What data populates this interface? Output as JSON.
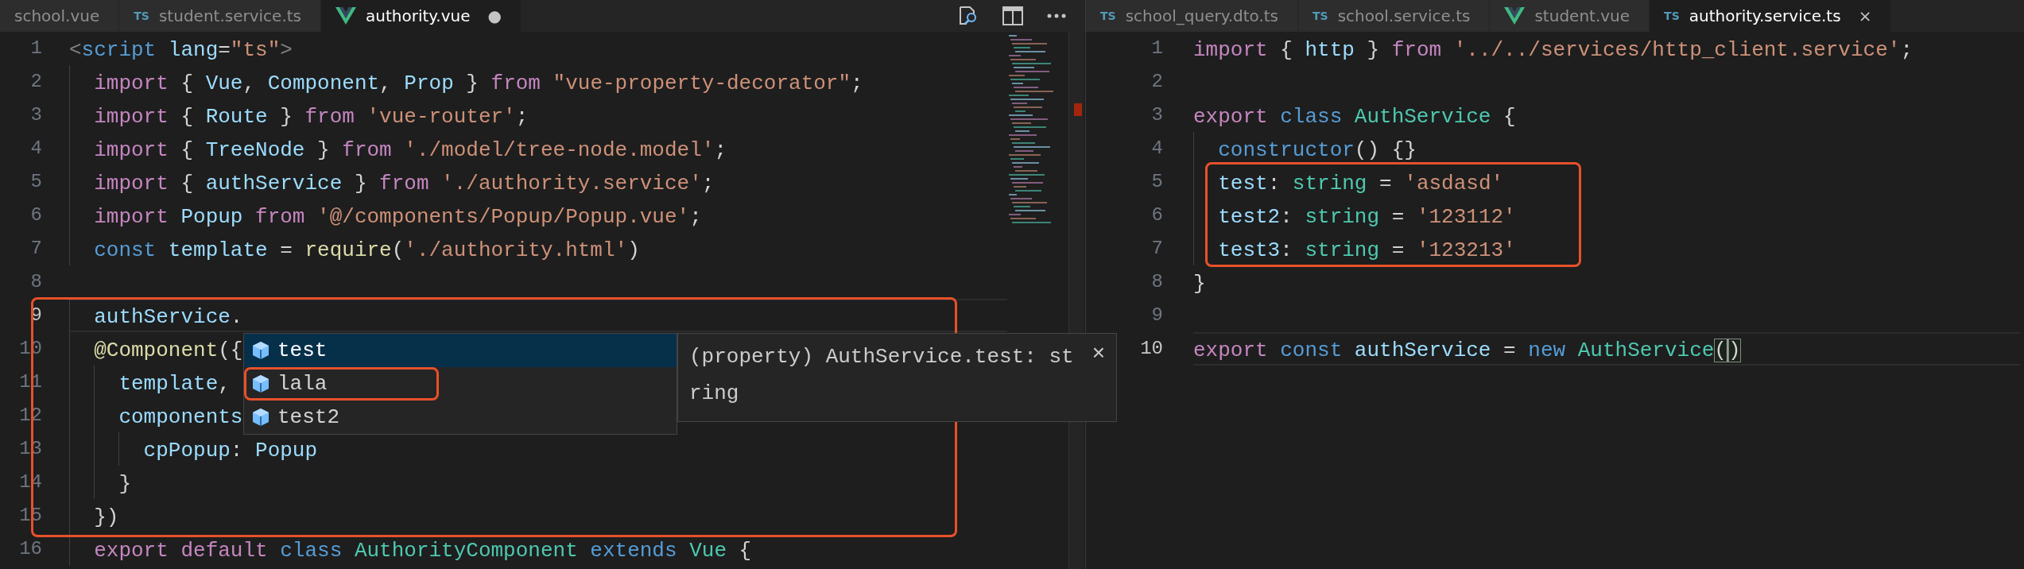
{
  "left_editor": {
    "tabs": [
      {
        "label": "school.vue",
        "kind": "plain",
        "selected": false
      },
      {
        "label": "student.service.ts",
        "kind": "ts",
        "icon_text": "TS",
        "selected": false
      },
      {
        "label": "authority.vue",
        "kind": "vue",
        "selected": true,
        "dirty_mark": "●"
      }
    ],
    "lines": [
      {
        "number": "1",
        "current": false,
        "boxed": false,
        "tokens": [
          {
            "text": "<",
            "kind": "punct"
          },
          {
            "text": "script ",
            "kind": "tag"
          },
          {
            "text": "lang",
            "kind": "attr"
          },
          {
            "text": "=",
            "kind": "plain"
          },
          {
            "text": "\"ts\"",
            "kind": "string"
          },
          {
            "text": ">",
            "kind": "punct"
          }
        ]
      },
      {
        "number": "2",
        "current": false,
        "boxed": false,
        "tokens": [
          {
            "text": "  import",
            "kind": "keyword"
          },
          {
            "text": " { ",
            "kind": "plain"
          },
          {
            "text": "Vue",
            "kind": "var"
          },
          {
            "text": ", ",
            "kind": "plain"
          },
          {
            "text": "Component",
            "kind": "var"
          },
          {
            "text": ", ",
            "kind": "plain"
          },
          {
            "text": "Prop",
            "kind": "var"
          },
          {
            "text": " } ",
            "kind": "plain"
          },
          {
            "text": "from ",
            "kind": "keyword"
          },
          {
            "text": "\"vue-property-decorator\"",
            "kind": "string"
          },
          {
            "text": ";",
            "kind": "plain"
          }
        ]
      },
      {
        "number": "3",
        "current": false,
        "boxed": false,
        "tokens": [
          {
            "text": "  import",
            "kind": "keyword"
          },
          {
            "text": " { ",
            "kind": "plain"
          },
          {
            "text": "Route",
            "kind": "var"
          },
          {
            "text": " } ",
            "kind": "plain"
          },
          {
            "text": "from ",
            "kind": "keyword"
          },
          {
            "text": "'vue-router'",
            "kind": "string"
          },
          {
            "text": ";",
            "kind": "plain"
          }
        ]
      },
      {
        "number": "4",
        "current": false,
        "boxed": false,
        "tokens": [
          {
            "text": "  import",
            "kind": "keyword"
          },
          {
            "text": " { ",
            "kind": "plain"
          },
          {
            "text": "TreeNode",
            "kind": "var"
          },
          {
            "text": " } ",
            "kind": "plain"
          },
          {
            "text": "from ",
            "kind": "keyword"
          },
          {
            "text": "'./model/tree-node.model'",
            "kind": "string"
          },
          {
            "text": ";",
            "kind": "plain"
          }
        ]
      },
      {
        "number": "5",
        "current": false,
        "boxed": false,
        "tokens": [
          {
            "text": "  import",
            "kind": "keyword"
          },
          {
            "text": " { ",
            "kind": "plain"
          },
          {
            "text": "authService",
            "kind": "var"
          },
          {
            "text": " } ",
            "kind": "plain"
          },
          {
            "text": "from ",
            "kind": "keyword"
          },
          {
            "text": "'./authority.service'",
            "kind": "string"
          },
          {
            "text": ";",
            "kind": "plain"
          }
        ]
      },
      {
        "number": "6",
        "current": false,
        "boxed": false,
        "tokens": [
          {
            "text": "  import ",
            "kind": "keyword"
          },
          {
            "text": "Popup ",
            "kind": "var"
          },
          {
            "text": "from ",
            "kind": "keyword"
          },
          {
            "text": "'@/components/Popup/Popup.vue'",
            "kind": "string"
          },
          {
            "text": ";",
            "kind": "plain"
          }
        ]
      },
      {
        "number": "7",
        "current": false,
        "boxed": false,
        "tokens": [
          {
            "text": "  const ",
            "kind": "storage"
          },
          {
            "text": "template",
            "kind": "var"
          },
          {
            "text": " = ",
            "kind": "plain"
          },
          {
            "text": "require",
            "kind": "func"
          },
          {
            "text": "(",
            "kind": "plain"
          },
          {
            "text": "'./authority.html'",
            "kind": "string"
          },
          {
            "text": ")",
            "kind": "plain"
          }
        ]
      },
      {
        "number": "8",
        "current": false,
        "boxed": false
      },
      {
        "number": "9",
        "current": true,
        "boxed": true,
        "tokens": [
          {
            "text": "  authService",
            "kind": "var"
          },
          {
            "text": ".",
            "kind": "plain"
          }
        ]
      },
      {
        "number": "10",
        "current": false,
        "boxed": true,
        "tokens": [
          {
            "text": "  @Component",
            "kind": "func"
          },
          {
            "text": "({",
            "kind": "plain"
          }
        ]
      },
      {
        "number": "11",
        "current": false,
        "boxed": true,
        "tokens": [
          {
            "text": "    template",
            "kind": "var"
          },
          {
            "text": ",",
            "kind": "plain"
          }
        ]
      },
      {
        "number": "12",
        "current": false,
        "boxed": true,
        "tokens": [
          {
            "text": "    components",
            "kind": "var"
          }
        ]
      },
      {
        "number": "13",
        "current": false,
        "boxed": true,
        "tokens": [
          {
            "text": "      cpPopup",
            "kind": "var"
          },
          {
            "text": ": ",
            "kind": "plain"
          },
          {
            "text": "Popup",
            "kind": "var"
          }
        ]
      },
      {
        "number": "14",
        "current": false,
        "boxed": true,
        "tokens": [
          {
            "text": "    }",
            "kind": "plain"
          }
        ]
      },
      {
        "number": "15",
        "current": false,
        "boxed": true,
        "tokens": [
          {
            "text": "  })",
            "kind": "plain"
          }
        ]
      },
      {
        "number": "16",
        "current": false,
        "boxed": false,
        "tokens": [
          {
            "text": "  export ",
            "kind": "keyword"
          },
          {
            "text": "default ",
            "kind": "keyword"
          },
          {
            "text": "class ",
            "kind": "storage"
          },
          {
            "text": "AuthorityComponent ",
            "kind": "type"
          },
          {
            "text": "extends ",
            "kind": "storage"
          },
          {
            "text": "Vue",
            "kind": "type"
          },
          {
            "text": " {",
            "kind": "plain"
          }
        ]
      }
    ],
    "suggestions": {
      "items": [
        {
          "label": "test",
          "selected": true,
          "marked": false
        },
        {
          "label": "lala",
          "selected": false,
          "marked": true
        },
        {
          "label": "test2",
          "selected": false,
          "marked": false
        }
      ],
      "detail": "(property) AuthService.test: string",
      "close": "×"
    }
  },
  "right_editor": {
    "tabs": [
      {
        "label": "school_query.dto.ts",
        "kind": "ts",
        "icon_text": "TS",
        "selected": false
      },
      {
        "label": "school.service.ts",
        "kind": "ts",
        "icon_text": "TS",
        "selected": false
      },
      {
        "label": "student.vue",
        "kind": "vue",
        "selected": false
      },
      {
        "label": "authority.service.ts",
        "kind": "ts",
        "icon_text": "TS",
        "selected": true,
        "close_mark": "×"
      }
    ],
    "lines": [
      {
        "number": "1",
        "current": false,
        "boxed": false,
        "tokens": [
          {
            "text": "import",
            "kind": "keyword"
          },
          {
            "text": " { ",
            "kind": "plain"
          },
          {
            "text": "http",
            "kind": "var"
          },
          {
            "text": " } ",
            "kind": "plain"
          },
          {
            "text": "from ",
            "kind": "keyword"
          },
          {
            "text": "'../../services/http_client.service'",
            "kind": "string"
          },
          {
            "text": ";",
            "kind": "plain"
          }
        ]
      },
      {
        "number": "2",
        "current": false,
        "boxed": false
      },
      {
        "number": "3",
        "current": false,
        "boxed": false,
        "tokens": [
          {
            "text": "export ",
            "kind": "keyword"
          },
          {
            "text": "class ",
            "kind": "storage"
          },
          {
            "text": "AuthService",
            "kind": "type"
          },
          {
            "text": " {",
            "kind": "plain"
          }
        ]
      },
      {
        "number": "4",
        "current": false,
        "boxed": false,
        "tokens": [
          {
            "text": "  constructor",
            "kind": "storage"
          },
          {
            "text": "() {}",
            "kind": "plain"
          }
        ]
      },
      {
        "number": "5",
        "current": false,
        "boxed": true,
        "tokens": [
          {
            "text": "  test",
            "kind": "var"
          },
          {
            "text": ": ",
            "kind": "plain"
          },
          {
            "text": "string",
            "kind": "type"
          },
          {
            "text": " = ",
            "kind": "plain"
          },
          {
            "text": "'asdasd'",
            "kind": "string"
          }
        ]
      },
      {
        "number": "6",
        "current": false,
        "boxed": true,
        "tokens": [
          {
            "text": "  test2",
            "kind": "var"
          },
          {
            "text": ": ",
            "kind": "plain"
          },
          {
            "text": "string",
            "kind": "type"
          },
          {
            "text": " = ",
            "kind": "plain"
          },
          {
            "text": "'123112'",
            "kind": "string"
          }
        ]
      },
      {
        "number": "7",
        "current": false,
        "boxed": true,
        "tokens": [
          {
            "text": "  test3",
            "kind": "var"
          },
          {
            "text": ": ",
            "kind": "plain"
          },
          {
            "text": "string",
            "kind": "type"
          },
          {
            "text": " = ",
            "kind": "plain"
          },
          {
            "text": "'123213'",
            "kind": "string"
          }
        ]
      },
      {
        "number": "8",
        "current": false,
        "boxed": false,
        "tokens": [
          {
            "text": "}",
            "kind": "plain"
          }
        ]
      },
      {
        "number": "9",
        "current": false,
        "boxed": false
      },
      {
        "number": "10",
        "current": true,
        "boxed": false,
        "tokens": [
          {
            "text": "export ",
            "kind": "keyword"
          },
          {
            "text": "const ",
            "kind": "storage"
          },
          {
            "text": "authService",
            "kind": "var"
          },
          {
            "text": " = ",
            "kind": "plain"
          },
          {
            "text": "new ",
            "kind": "storage"
          },
          {
            "text": "AuthService",
            "kind": "type"
          },
          {
            "text": "(",
            "kind": "bracket-caret"
          },
          {
            "text": ")",
            "kind": "bracket"
          }
        ]
      }
    ]
  }
}
